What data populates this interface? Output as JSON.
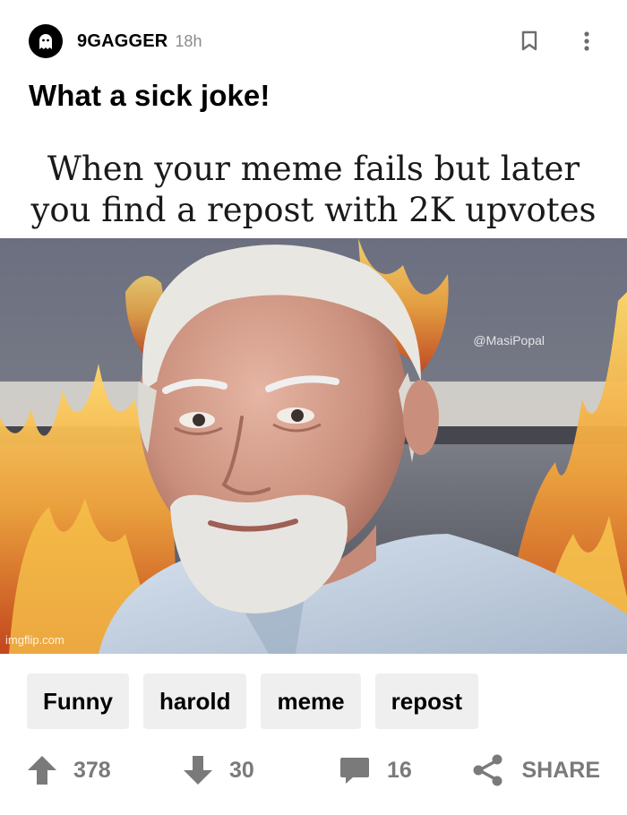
{
  "post": {
    "username": "9GAGGER",
    "time": "18h",
    "title": "What a sick joke!"
  },
  "meme": {
    "caption_line1": "When your meme fails but later",
    "caption_line2": "you find a repost with 2K upvotes",
    "watermark_corner": "imgflip.com",
    "watermark_right": "@MasiPopal"
  },
  "tags": [
    "Funny",
    "harold",
    "meme",
    "repost"
  ],
  "actions": {
    "upvotes": "378",
    "downvotes": "30",
    "comments": "16",
    "share_label": "SHARE"
  },
  "icons": {
    "avatar": "ghost-icon",
    "bookmark": "bookmark-icon",
    "more": "more-vertical-icon",
    "upvote": "arrow-up-icon",
    "downvote": "arrow-down-icon",
    "comment": "comment-icon",
    "share": "share-icon"
  },
  "colors": {
    "text": "#000000",
    "muted": "#7a7a7a",
    "tag_bg": "#efefef"
  }
}
